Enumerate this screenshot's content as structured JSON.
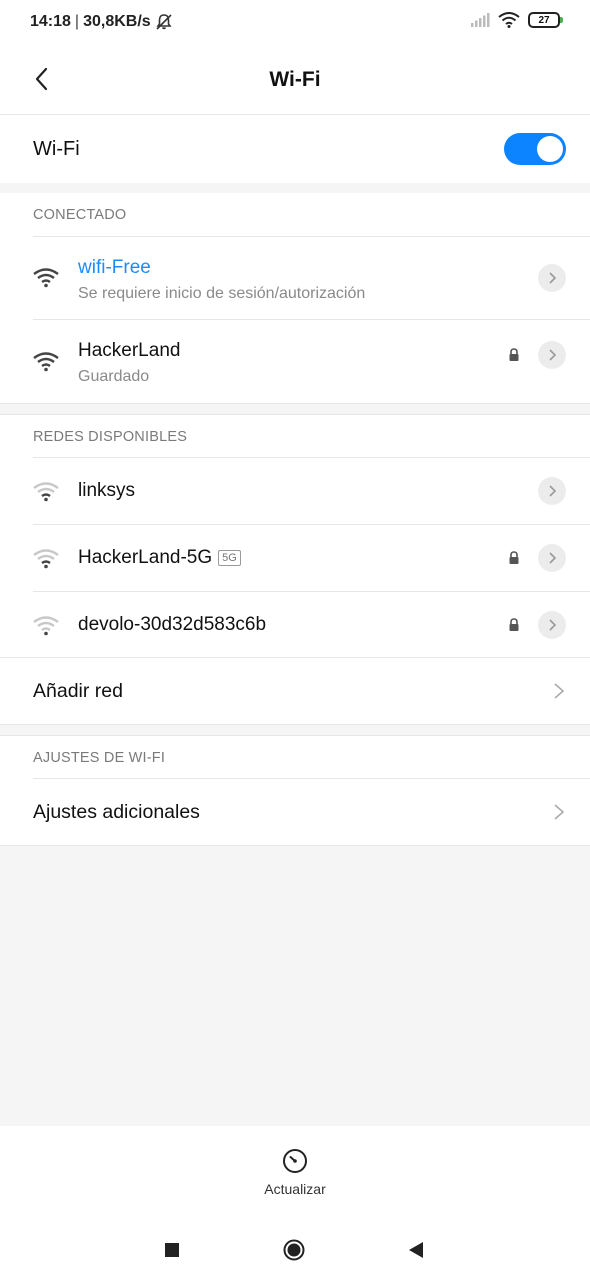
{
  "status_bar": {
    "time": "14:18",
    "net_speed": "30,8KB/s",
    "battery": "27"
  },
  "header": {
    "title": "Wi-Fi"
  },
  "wifi_toggle": {
    "label": "Wi-Fi",
    "on": true
  },
  "connected": {
    "header": "CONECTADO",
    "networks": [
      {
        "name": "wifi-Free",
        "status": "Se requiere inicio de sesión/autorización",
        "locked": false,
        "active": true
      },
      {
        "name": "HackerLand",
        "status": "Guardado",
        "locked": true,
        "active": false
      }
    ]
  },
  "available": {
    "header": "REDES DISPONIBLES",
    "networks": [
      {
        "name": "linksys",
        "badge": "",
        "locked": false
      },
      {
        "name": "HackerLand-5G",
        "badge": "5G",
        "locked": true
      },
      {
        "name": "devolo-30d32d583c6b",
        "badge": "",
        "locked": true
      }
    ],
    "add_network": "Añadir red"
  },
  "wifi_settings": {
    "header": "AJUSTES DE WI-FI",
    "additional": "Ajustes adicionales"
  },
  "bottom_action": {
    "label": "Actualizar"
  },
  "colors": {
    "accent": "#0d84ff",
    "active_network": "#1a8cff"
  }
}
